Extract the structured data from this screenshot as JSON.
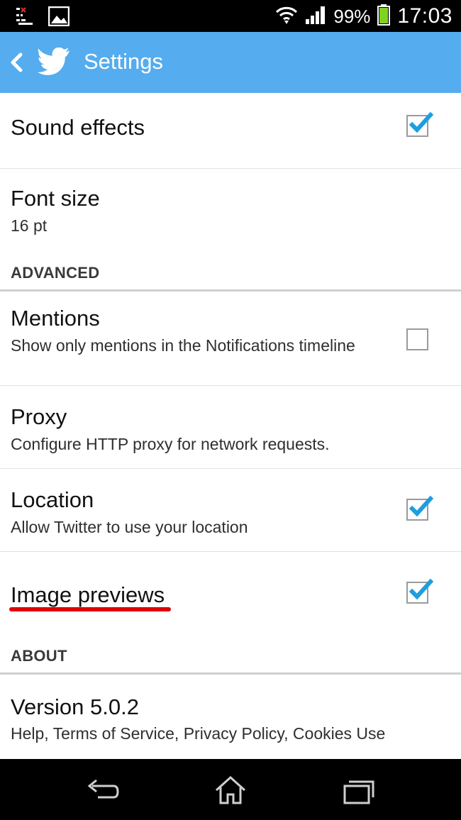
{
  "status_bar": {
    "battery_percent": "99%",
    "time": "17:03",
    "icons": [
      "notification-icon",
      "image-icon",
      "wifi-icon",
      "signal-icon",
      "battery-icon"
    ]
  },
  "action_bar": {
    "title": "Settings",
    "background": "#55acee"
  },
  "settings": {
    "sound_effects": {
      "title": "Sound effects",
      "checked": true
    },
    "font_size": {
      "title": "Font size",
      "value": "16 pt"
    },
    "advanced_header": "ADVANCED",
    "mentions": {
      "title": "Mentions",
      "summary": "Show only mentions in the Notifications timeline",
      "checked": false
    },
    "proxy": {
      "title": "Proxy",
      "summary": "Configure HTTP proxy for network requests."
    },
    "location": {
      "title": "Location",
      "summary": "Allow Twitter to use your location",
      "checked": true
    },
    "image_previews": {
      "title": "Image previews",
      "checked": true
    },
    "about_header": "ABOUT",
    "version": {
      "title": "Version 5.0.2",
      "summary": "Help, Terms of Service, Privacy Policy, Cookies Use"
    }
  },
  "colors": {
    "accent": "#55acee",
    "checkmark": "#1e9ee0",
    "annotation_underline": "#e00000"
  },
  "nav_bar": {
    "icons": [
      "back-icon",
      "home-icon",
      "recent-apps-icon"
    ]
  }
}
